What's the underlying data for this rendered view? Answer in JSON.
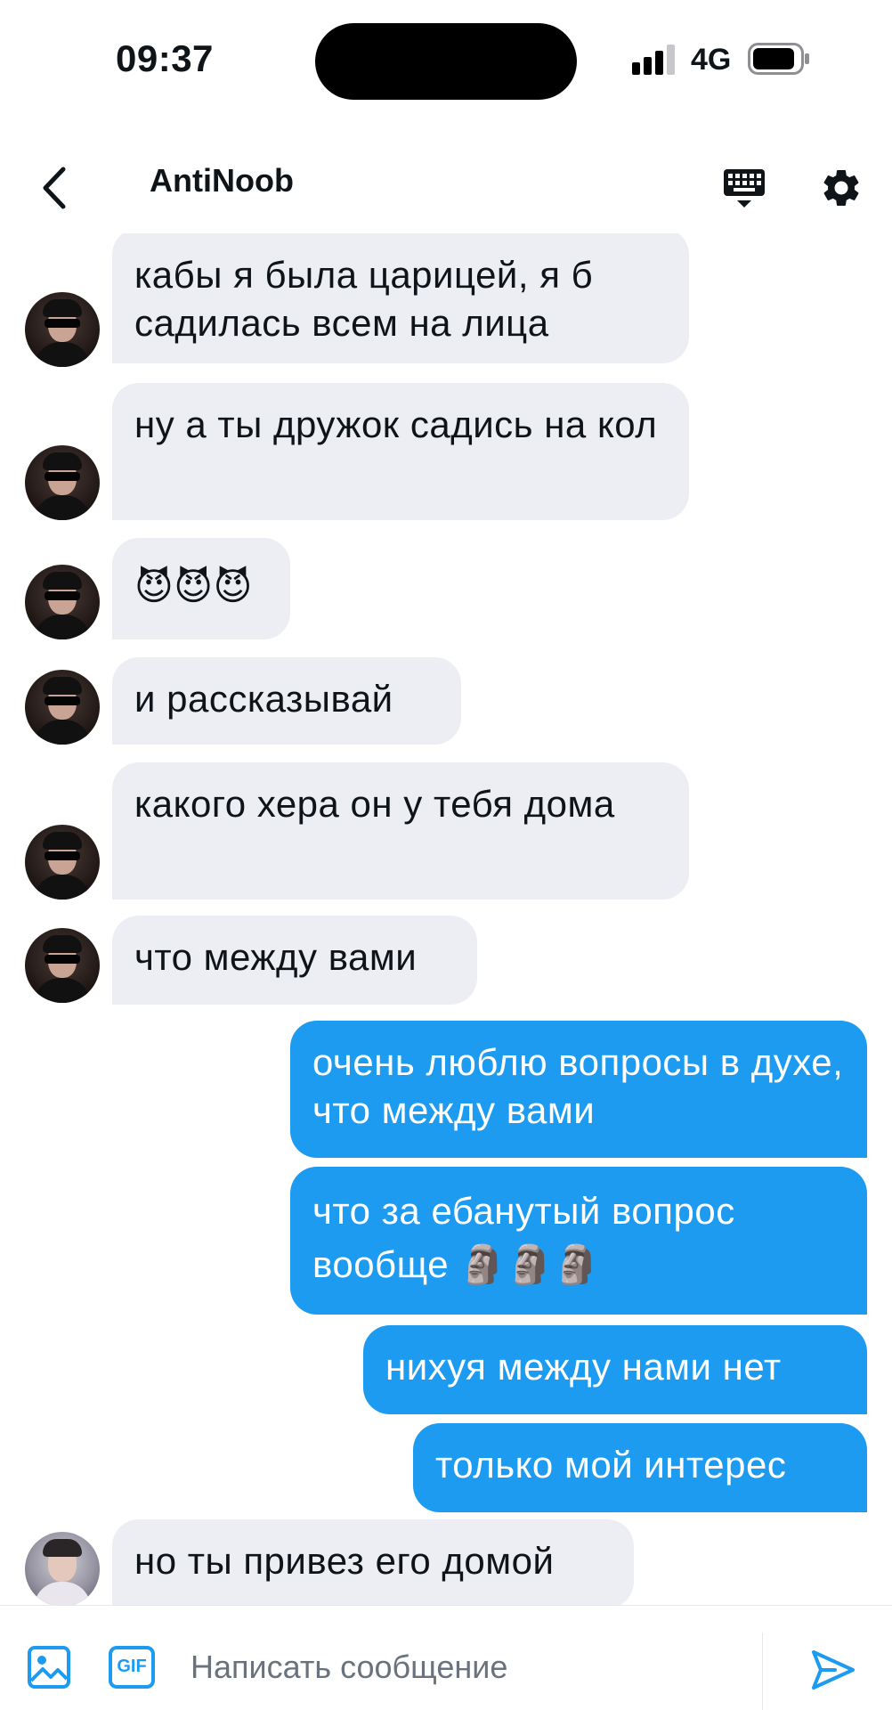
{
  "status_bar": {
    "time": "09:37",
    "network": "4G",
    "icons": [
      "signal-icon",
      "battery-icon"
    ]
  },
  "header": {
    "title": "AntiNoob",
    "icons": [
      "back-arrow-icon",
      "keyboard-icon",
      "gear-icon"
    ]
  },
  "messages": [
    {
      "side": "in",
      "text": "кабы я была царицей, я б садилась всем на лица"
    },
    {
      "side": "in",
      "text": "ну а ты дружок садись на кол"
    },
    {
      "side": "in",
      "text": "😈😈😈"
    },
    {
      "side": "in",
      "text": "и рассказывай"
    },
    {
      "side": "in",
      "text": "какого хера он у тебя дома"
    },
    {
      "side": "in",
      "text": "что между вами"
    },
    {
      "side": "out",
      "text": "очень люблю вопросы в духе, что между вами"
    },
    {
      "side": "out",
      "text": "что за ебанутый вопрос вообще 🗿🗿🗿"
    },
    {
      "side": "out",
      "text": "нихуя между нами нет"
    },
    {
      "side": "out",
      "text": "только мой интерес"
    },
    {
      "side": "in",
      "text": "но ты привез его домой"
    }
  ],
  "composer": {
    "placeholder": "Написать сообщение",
    "gif_label": "GIF",
    "icons": [
      "image-icon",
      "gif-icon",
      "send-icon"
    ]
  },
  "colors": {
    "outgoing_bubble": "#1d9bf0",
    "incoming_bubble": "#eceef3",
    "accent": "#1d9bf0"
  }
}
